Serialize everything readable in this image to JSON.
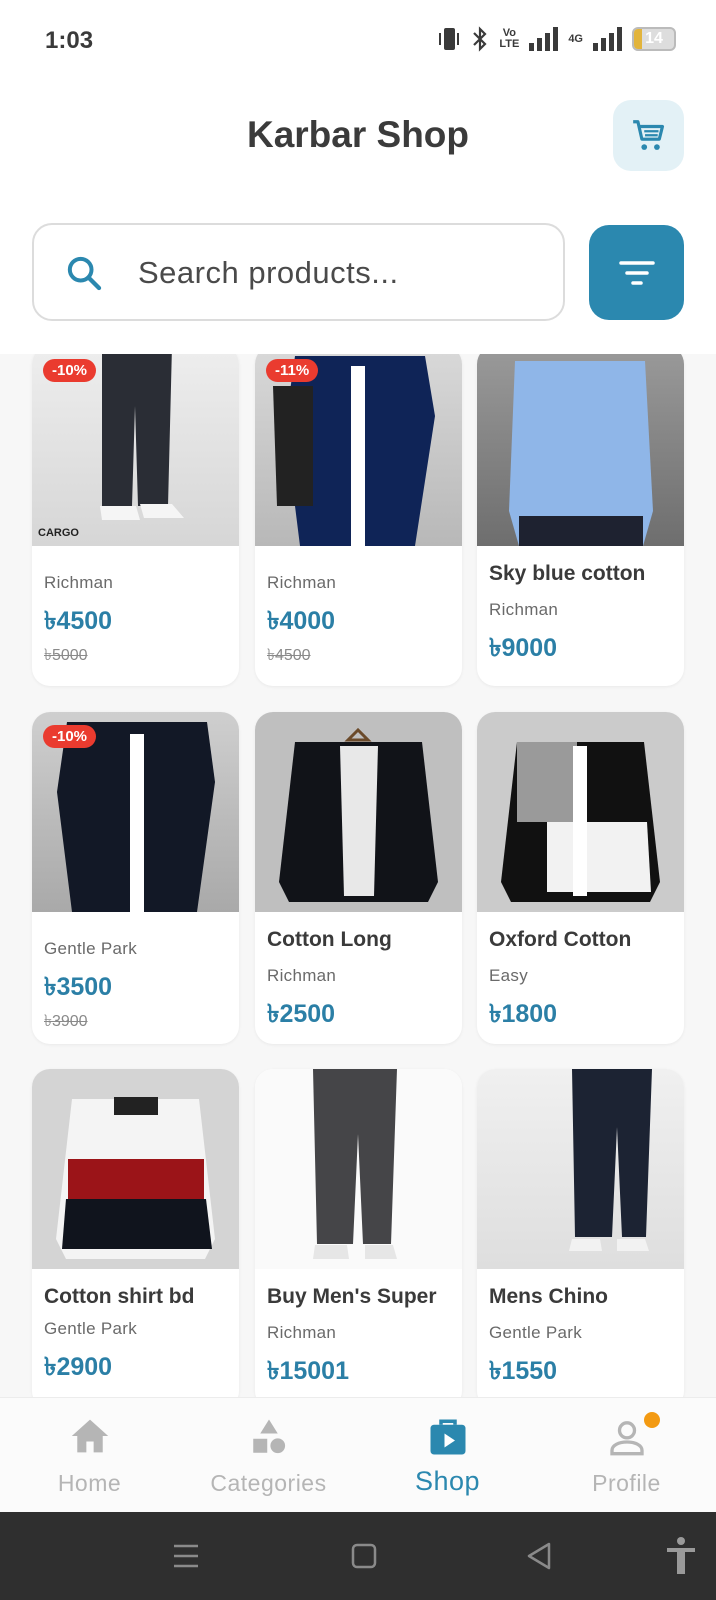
{
  "status_bar": {
    "time": "1:03",
    "network_label_top": "Vo",
    "network_label_bottom": "LTE",
    "network_type": "4G",
    "battery": "14"
  },
  "header": {
    "title": "Karbar Shop",
    "cart_icon": "cart-icon"
  },
  "search": {
    "placeholder": "Search products...",
    "value": ""
  },
  "colors": {
    "accent": "#2b88af",
    "price": "#2b7fa6",
    "badge": "#ea3b2f",
    "notification_dot": "#f39a12"
  },
  "products": [
    {
      "title": "",
      "brand": "Richman",
      "price": "৳4500",
      "old_price": "৳5000",
      "discount": "-10%"
    },
    {
      "title": "",
      "brand": "Richman",
      "price": "৳4000",
      "old_price": "৳4500",
      "discount": "-11%"
    },
    {
      "title": "Sky blue cotton",
      "brand": "Richman",
      "price": "৳9000",
      "old_price": "",
      "discount": ""
    },
    {
      "title": "",
      "brand": "Gentle Park",
      "price": "৳3500",
      "old_price": "৳3900",
      "discount": "-10%"
    },
    {
      "title": "Cotton Long",
      "brand": "Richman",
      "price": "৳2500",
      "old_price": "",
      "discount": ""
    },
    {
      "title": "Oxford Cotton",
      "brand": "Easy",
      "price": "৳1800",
      "old_price": "",
      "discount": ""
    },
    {
      "title": "Cotton shirt bd",
      "brand": "Gentle Park",
      "price": "৳2900",
      "old_price": "",
      "discount": ""
    },
    {
      "title": "Buy Men's Super",
      "brand": "Richman",
      "price": "৳15001",
      "old_price": "",
      "discount": ""
    },
    {
      "title": "Mens Chino",
      "brand": "Gentle Park",
      "price": "৳1550",
      "old_price": "",
      "discount": ""
    }
  ],
  "bottom_nav": [
    {
      "label": "Home",
      "icon": "home-icon",
      "active": false
    },
    {
      "label": "Categories",
      "icon": "categories-icon",
      "active": false
    },
    {
      "label": "Shop",
      "icon": "shop-icon",
      "active": true
    },
    {
      "label": "Profile",
      "icon": "profile-icon",
      "active": false
    }
  ]
}
